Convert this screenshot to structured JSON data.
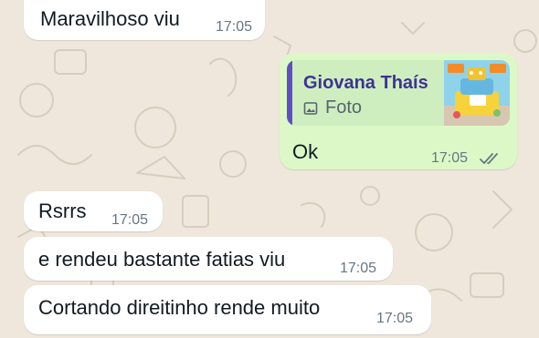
{
  "theme": {
    "chat_background": "#efe7dc",
    "incoming_bubble": "#ffffff",
    "outgoing_bubble": "#dcf8c6",
    "quote_bar": "#5e4fc4",
    "read_ticks": "#667781"
  },
  "messages": [
    {
      "direction": "incoming",
      "text": "Maravilhoso viu",
      "time": "17:05"
    },
    {
      "direction": "outgoing",
      "reply_to": {
        "author": "Giovana Thaís",
        "type_label": "Foto",
        "type_icon": "photo-icon",
        "thumbnail_icon": "cake-photo-thumbnail"
      },
      "text": "Ok",
      "time": "17:05",
      "status_icon": "double-check-icon"
    },
    {
      "direction": "incoming",
      "text": "Rsrrs",
      "time": "17:05"
    },
    {
      "direction": "incoming",
      "text": "e rendeu bastante fatias  viu",
      "time": "17:05"
    },
    {
      "direction": "incoming",
      "text": "Cortando direitinho rende muito",
      "time": "17:05"
    }
  ]
}
